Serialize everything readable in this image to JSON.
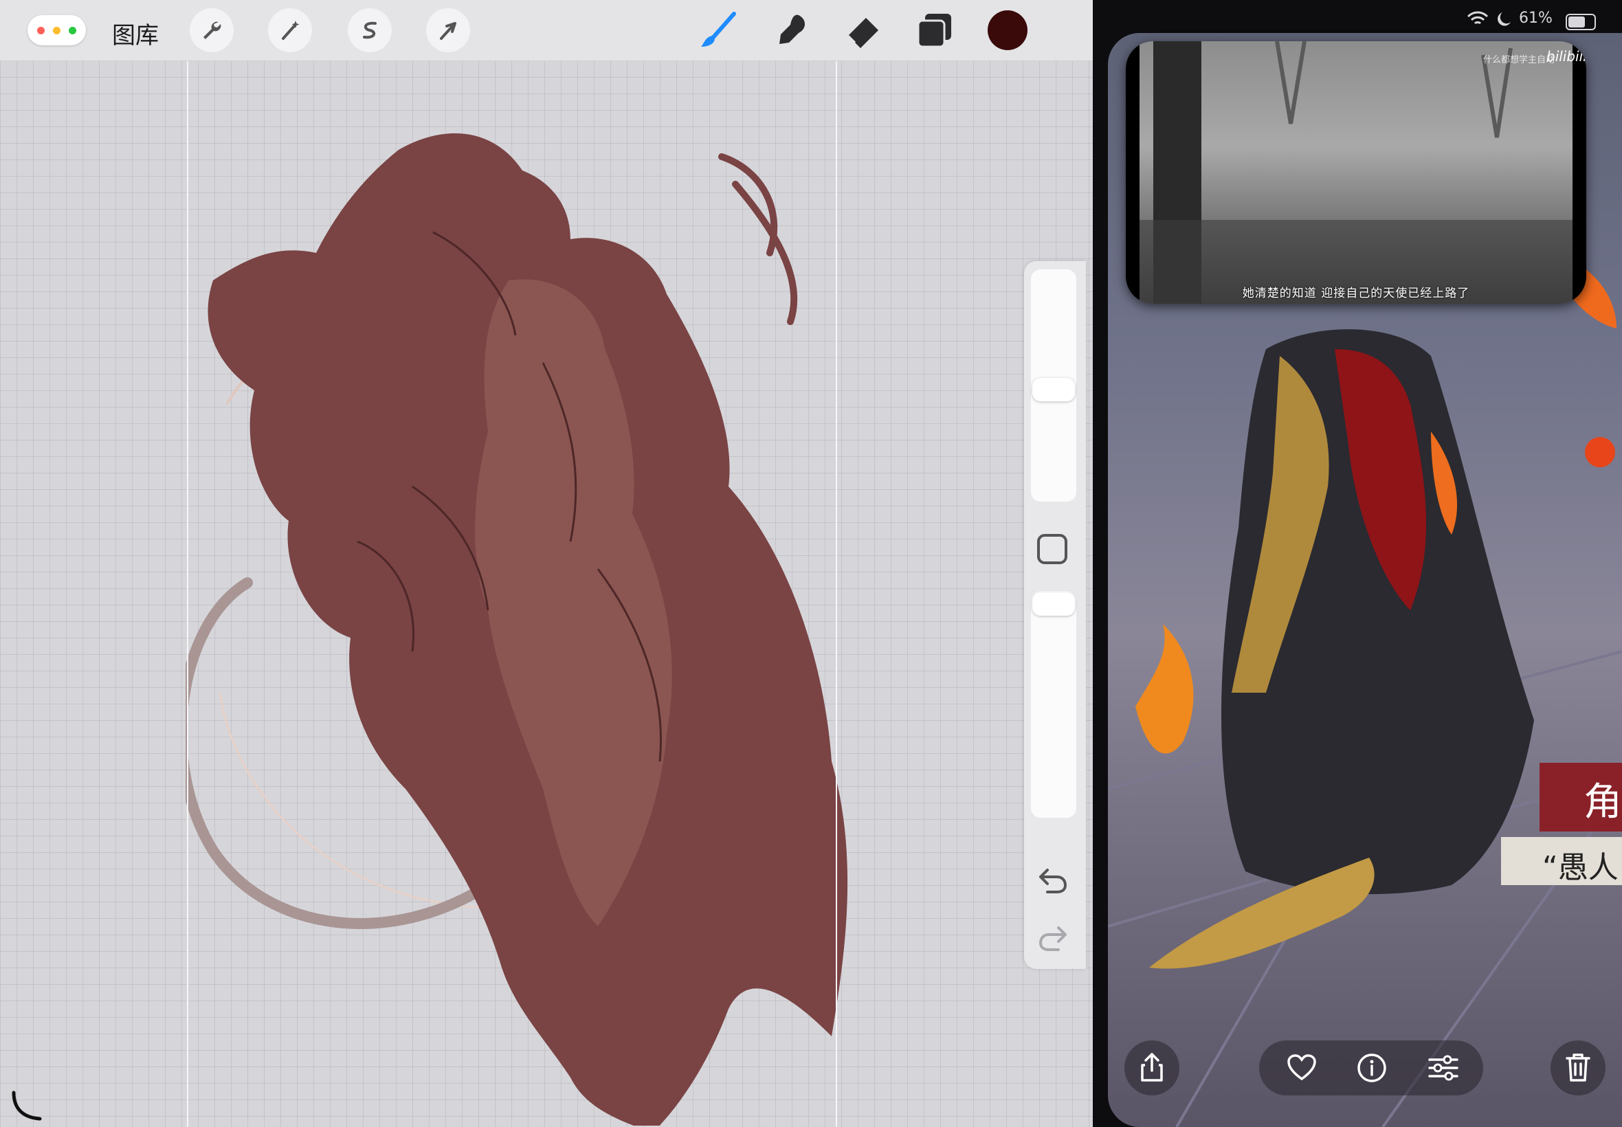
{
  "procreate": {
    "gallery_label": "图库",
    "brush_color": "#3a0a0a"
  },
  "status_bar": {
    "battery_text": "61%"
  },
  "video_pip": {
    "subtitle": "她清楚的知道 迎接自己的天使已经上路了",
    "watermark": "什么都想学主自动",
    "platform_logo": "bilibili"
  },
  "photo": {
    "banner_char": "角",
    "banner_text": "“愚人"
  }
}
